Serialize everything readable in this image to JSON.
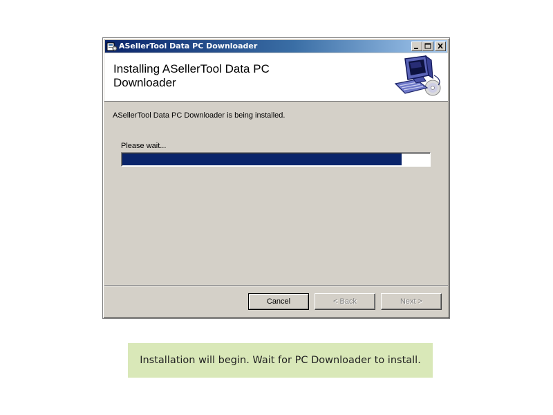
{
  "window": {
    "title": "ASellerTool Data PC Downloader",
    "icon": "installer-icon"
  },
  "header": {
    "title": "Installing ASellerTool Data PC Downloader",
    "graphic": "computer-with-cd-icon"
  },
  "body": {
    "status_text": "ASellerTool Data PC Downloader is being installed.",
    "wait_label": "Please wait...",
    "progress": 0.91
  },
  "buttons": {
    "cancel": "Cancel",
    "back": "< Back",
    "next": "Next >"
  },
  "caption": {
    "text": "Installation will begin. Wait for PC Downloader to install."
  },
  "colors": {
    "title_active": "#0a246a",
    "progress_fill": "#0a246a",
    "dialog_face": "#d4d0c8",
    "caption_background": "#d9e8b8"
  }
}
